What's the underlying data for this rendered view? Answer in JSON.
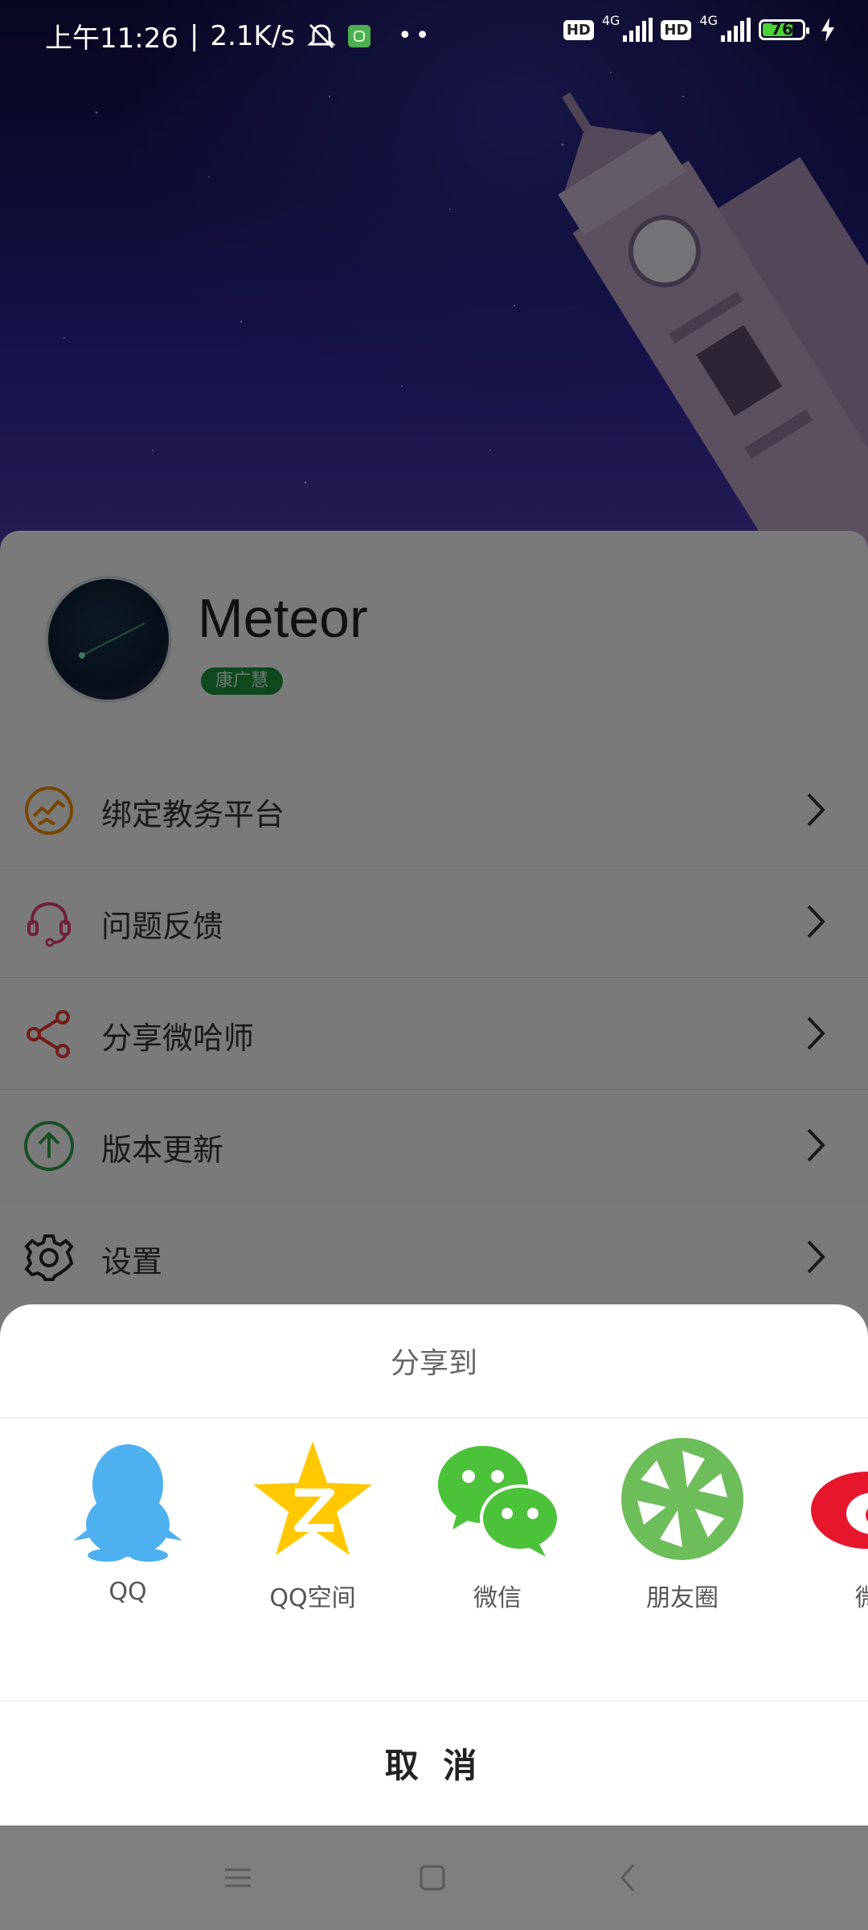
{
  "status_bar": {
    "time": "上午11:26",
    "speed": "2.1K/s",
    "network_1": "4G",
    "network_2": "4G",
    "hd_label": "HD",
    "battery_percent": "76",
    "icons": [
      "mute-bell-icon",
      "app-notification-icon",
      "more-dots-icon",
      "signal-icon",
      "battery-icon",
      "charging-icon"
    ]
  },
  "profile": {
    "username": "Meteor",
    "tag": "康广慧"
  },
  "menu": {
    "items": [
      {
        "label": "绑定教务平台",
        "icon": "globe-icon",
        "color": "#f08c00"
      },
      {
        "label": "问题反馈",
        "icon": "headset-icon",
        "color": "#e0407a"
      },
      {
        "label": "分享微哈师",
        "icon": "share-icon",
        "color": "#e53935"
      },
      {
        "label": "版本更新",
        "icon": "upload-arrow-icon",
        "color": "#2e9e4f"
      },
      {
        "label": "设置",
        "icon": "gear-icon",
        "color": "#222222"
      }
    ]
  },
  "share_sheet": {
    "title": "分享到",
    "targets": [
      {
        "label": "QQ",
        "icon": "qq-icon",
        "color": "#4fb0f0"
      },
      {
        "label": "QQ空间",
        "icon": "qzone-icon",
        "color": "#ffc800"
      },
      {
        "label": "微信",
        "icon": "wechat-icon",
        "color": "#4cc23a"
      },
      {
        "label": "朋友圈",
        "icon": "moments-icon",
        "color": "#6dbd5b"
      },
      {
        "label": "微",
        "icon": "weibo-icon",
        "color": "#e6162d"
      }
    ],
    "cancel_label": "取 消"
  },
  "nav_bar": {
    "icons": [
      "menu-icon",
      "home-icon",
      "back-icon"
    ]
  }
}
